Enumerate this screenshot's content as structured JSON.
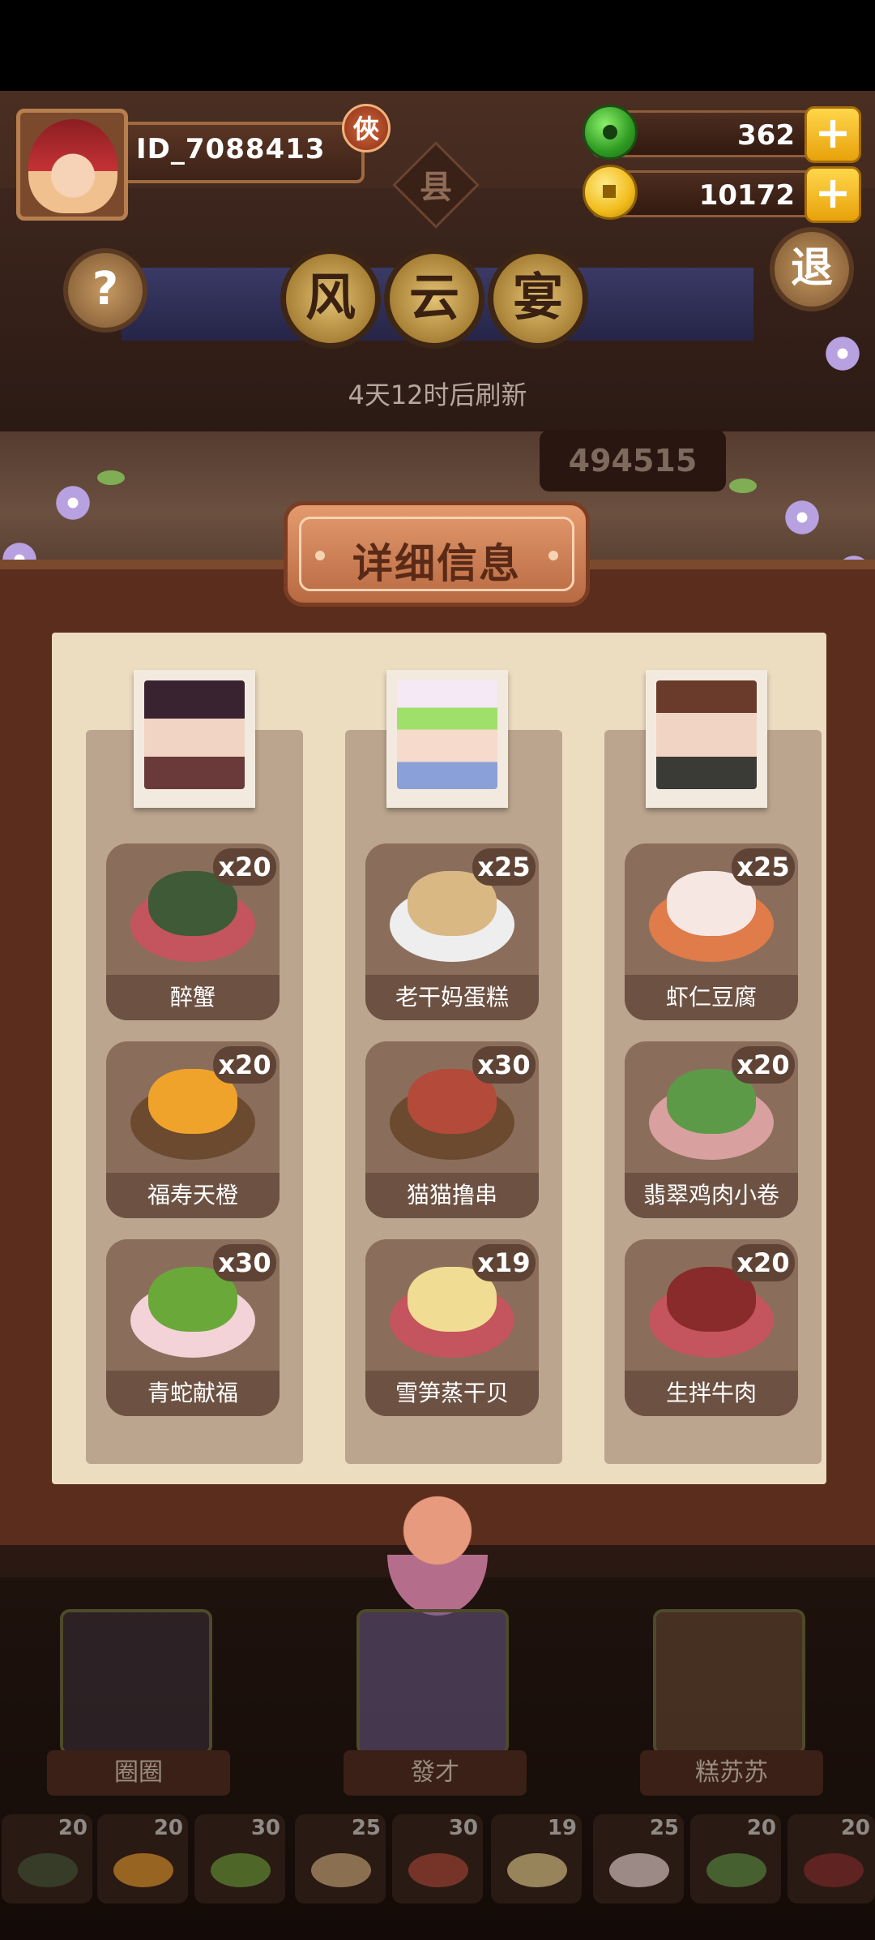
{
  "player": {
    "id": "ID_7088413",
    "rank_badge": "俠"
  },
  "currencies": {
    "jade": {
      "icon": "jade-coin-icon",
      "value": "362"
    },
    "gold": {
      "icon": "gold-coin-icon",
      "value": "10172"
    }
  },
  "header": {
    "county": "县",
    "help": "?",
    "exit": "退",
    "title_chars": [
      "风",
      "云",
      "宴"
    ],
    "refresh_text": "4天12时后刷新",
    "score": "494515"
  },
  "panel": {
    "title": "详细信息",
    "columns": [
      {
        "portrait": "chef-quanquan-portrait",
        "dishes": [
          {
            "name": "醉蟹",
            "qty": "x20",
            "food_color": "#3f5a37",
            "plate_color": "#c4545d"
          },
          {
            "name": "福寿天橙",
            "qty": "x20",
            "food_color": "#f0a32b",
            "plate_color": "#6b4a2f"
          },
          {
            "name": "青蛇献福",
            "qty": "x30",
            "food_color": "#6ba83a",
            "plate_color": "#f3d2d8"
          }
        ]
      },
      {
        "portrait": "chef-facai-portrait",
        "dishes": [
          {
            "name": "老干妈蛋糕",
            "qty": "x25",
            "food_color": "#d9b883",
            "plate_color": "#eeeeee"
          },
          {
            "name": "猫猫撸串",
            "qty": "x30",
            "food_color": "#b44a3a",
            "plate_color": "#6b4a2f"
          },
          {
            "name": "雪笋蒸干贝",
            "qty": "x19",
            "food_color": "#f1dc93",
            "plate_color": "#c4545d"
          }
        ]
      },
      {
        "portrait": "chef-gaosusu-portrait",
        "dishes": [
          {
            "name": "虾仁豆腐",
            "qty": "x25",
            "food_color": "#f7e7e3",
            "plate_color": "#e07b4a"
          },
          {
            "name": "翡翠鸡肉小卷",
            "qty": "x20",
            "food_color": "#5d9a47",
            "plate_color": "#d9a0a0"
          },
          {
            "name": "生拌牛肉",
            "qty": "x20",
            "food_color": "#8a2b2b",
            "plate_color": "#c4545d"
          }
        ]
      }
    ]
  },
  "chefs": [
    {
      "name": "圈圈",
      "color": "#3a2f38"
    },
    {
      "name": "發才",
      "color": "#6a5a86"
    },
    {
      "name": "糕苏苏",
      "color": "#6a4a35"
    }
  ],
  "inventory": [
    {
      "count": "20",
      "color": "#3f5a37"
    },
    {
      "count": "20",
      "color": "#f0a32b"
    },
    {
      "count": "30",
      "color": "#6ba83a"
    },
    {
      "count": "25",
      "color": "#d9b883"
    },
    {
      "count": "30",
      "color": "#b44a3a"
    },
    {
      "count": "19",
      "color": "#f1dc93"
    },
    {
      "count": "25",
      "color": "#f7e7e3"
    },
    {
      "count": "20",
      "color": "#5d9a47"
    },
    {
      "count": "20",
      "color": "#8a2b2b"
    }
  ],
  "colors": {
    "accent_gold": "#f1bc1c",
    "panel": "#ecdcc0",
    "frame": "#5a2d1d"
  }
}
